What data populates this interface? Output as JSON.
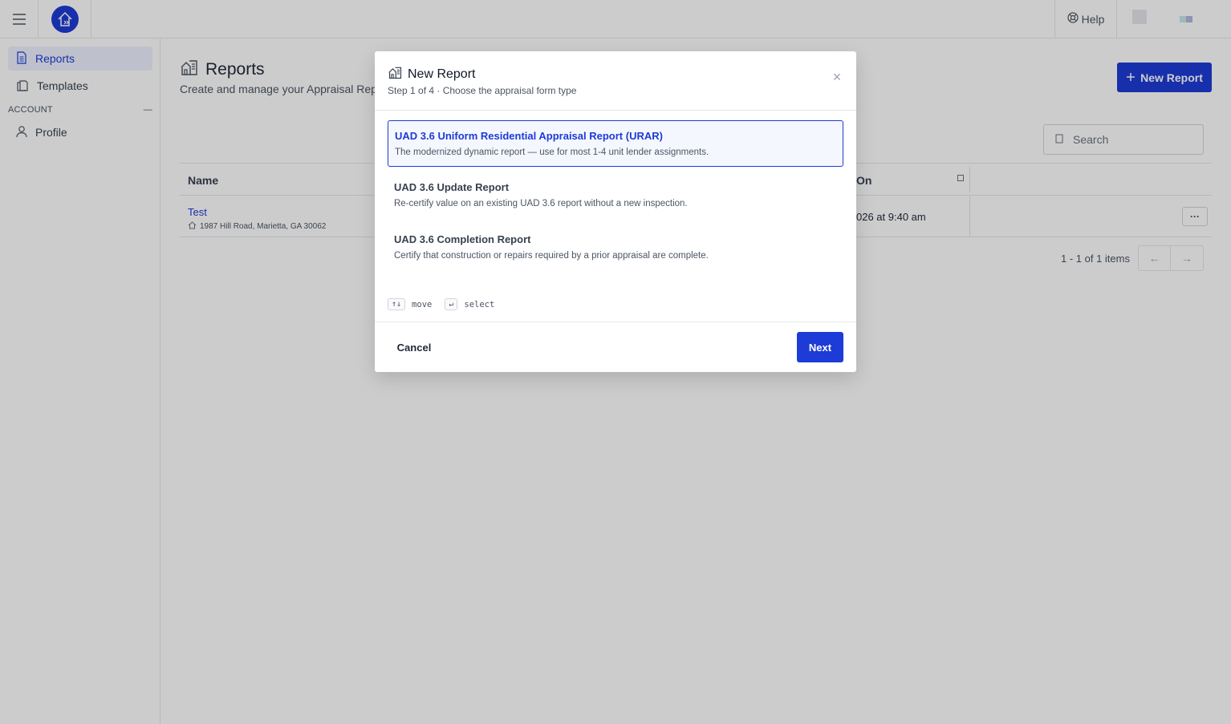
{
  "topbar": {
    "help_label": "Help",
    "brand_color": "#1d3bd6"
  },
  "sidebar": {
    "items": [
      {
        "label": "Reports",
        "icon": "document-icon",
        "active": true
      },
      {
        "label": "Templates",
        "icon": "copy-icon",
        "active": false
      }
    ],
    "section_label": "ACCOUNT",
    "section_collapse_glyph": "—",
    "account_items": [
      {
        "label": "Profile",
        "icon": "user-icon"
      }
    ]
  },
  "page": {
    "title": "Reports",
    "subtitle": "Create and manage your Appraisal Reports",
    "new_report_label": "New Report",
    "search_placeholder": "Search"
  },
  "table": {
    "columns": [
      "Name",
      "On"
    ],
    "rows": [
      {
        "name": "Test",
        "address": "1987 Hill Road, Marietta, GA 30062",
        "date": "026 at 9:40 am",
        "more": "···"
      }
    ],
    "pagination": "1 - 1 of 1 items",
    "prev_glyph": "←",
    "next_glyph": "→"
  },
  "modal": {
    "title": "New Report",
    "step": "Step 1 of 4 · Choose the appraisal form type",
    "options": [
      {
        "title": "UAD 3.6 Uniform Residential Appraisal Report (URAR)",
        "desc": "The modernized dynamic report — use for most 1-4 unit lender assignments.",
        "selected": true
      },
      {
        "title": "UAD 3.6 Update Report",
        "desc": "Re-certify value on an existing UAD 3.6 report without a new inspection.",
        "selected": false
      },
      {
        "title": "UAD 3.6 Completion Report",
        "desc": "Certify that construction or repairs required by a prior appraisal are complete.",
        "selected": false
      }
    ],
    "hints": {
      "move_key": "↑↓",
      "move_label": "move",
      "select_key": "↵",
      "select_label": "select"
    },
    "cancel_label": "Cancel",
    "next_label": "Next",
    "close_glyph": "×"
  }
}
